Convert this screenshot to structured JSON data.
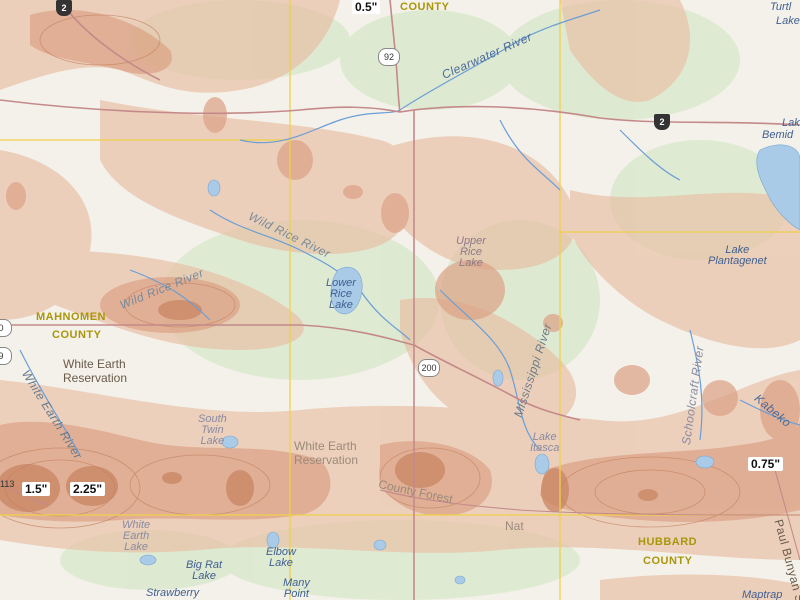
{
  "map": {
    "colors": {
      "land": "#f4f1ea",
      "forest": "#d6e6c8",
      "snow_light": "#e7b79a",
      "snow_medium": "#d89878",
      "snow_heavy": "#c97a55",
      "water": "#a9cbe8",
      "river": "#6a9ed6",
      "county_line": "#f2d24a",
      "road": "#c48a8a"
    },
    "amount_labels": {
      "top": "0.5\"",
      "west_low": "1.5\"",
      "west_high": "2.25\"",
      "east": "0.75\""
    },
    "counties": {
      "top": "COUNTY",
      "mahnomen_1": "MAHNOMEN",
      "mahnomen_2": "COUNTY",
      "hubbard_1": "HUBBARD",
      "hubbard_2": "COUNTY"
    },
    "places": {
      "white_earth_res_1": "White Earth",
      "white_earth_res_2": "Reservation",
      "white_earth_res_b1": "White Earth",
      "white_earth_res_b2": "Reservation",
      "county_forest": "County Forest",
      "nat": "Nat",
      "lake_bemidji_1": "Lake",
      "lake_bemidji_2": "Bemid",
      "turtle": "Turtl",
      "turtle_lake": "Lake",
      "paul_bunyan": "Paul Bunyan St",
      "kabekona": "Kabeko"
    },
    "lakes": {
      "lower_rice_1": "Lower",
      "lower_rice_2": "Rice",
      "lower_rice_3": "Lake",
      "upper_rice_1": "Upper",
      "upper_rice_2": "Rice",
      "upper_rice_3": "Lake",
      "south_twin_1": "South",
      "south_twin_2": "Twin",
      "south_twin_3": "Lake",
      "itasca_1": "Lake",
      "itasca_2": "Itasca",
      "plantagenet_1": "Lake",
      "plantagenet_2": "Plantagenet",
      "white_earth_1": "White",
      "white_earth_2": "Earth",
      "white_earth_3": "Lake",
      "big_rat_1": "Big Rat",
      "big_rat_2": "Lake",
      "elbow_1": "Elbow",
      "elbow_2": "Lake",
      "many_point_1": "Many",
      "many_point_2": "Point",
      "strawberry": "Strawberry",
      "maptrap": "Maptrap"
    },
    "rivers": {
      "clearwater": "Clearwater River",
      "wild_rice_1": "Wild Rice River",
      "wild_rice_2": "Wild Rice River",
      "mississippi": "Mississippi River",
      "white_earth": "White Earth River",
      "schoolcraft": "Schoolcraft River"
    },
    "routes": {
      "hwy_2_west": "2",
      "hwy_92": "92",
      "hwy_2_east": "2",
      "hwy_200": "200",
      "hwy_left_1": "0",
      "hwy_left_2": "9",
      "hwy_113": "113"
    }
  }
}
